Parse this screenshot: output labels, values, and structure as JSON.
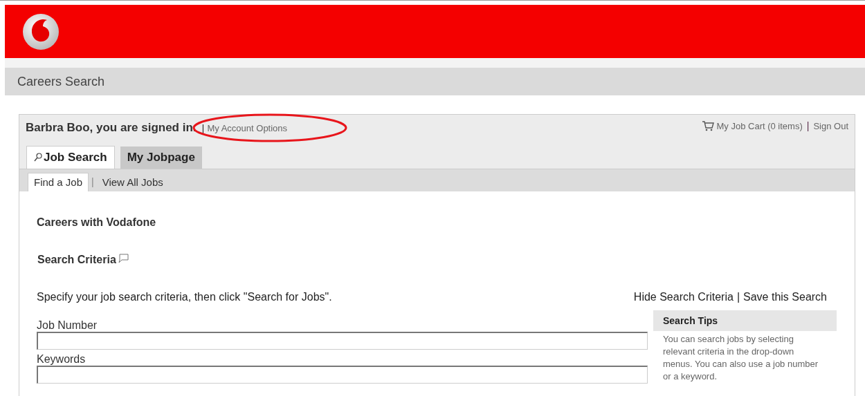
{
  "header": {
    "page_title": "Careers Search"
  },
  "account": {
    "greeting": "Barbra Boo, you are signed in.",
    "separator": "|",
    "account_link": "My Account Options",
    "cart_link": "My Job Cart (0 items)",
    "separator_2": "|",
    "sign_out": "Sign Out",
    "highlighted": true
  },
  "tabs": [
    {
      "label": "Job Search",
      "selected": true,
      "has_icon": true
    },
    {
      "label": "My Jobpage",
      "selected": false,
      "has_icon": false
    }
  ],
  "subtabs": [
    {
      "label": "Find a Job",
      "selected": true
    },
    {
      "label": "View All Jobs",
      "selected": false
    }
  ],
  "subtab_separator": "|",
  "content": {
    "heading": "Careers with Vodafone",
    "section_title": "Search Criteria",
    "instruction": "Specify your job search criteria, then click \"Search for Jobs\".",
    "links": [
      "Hide Search Criteria",
      "Save this Search"
    ],
    "link_separator": "|",
    "fields": [
      {
        "label": "Job Number"
      },
      {
        "label": "Keywords"
      }
    ],
    "tips": {
      "title": "Search Tips",
      "text": "You can search jobs by selecting relevant criteria in the drop-down menus. You can also use a job number or a keyword."
    }
  }
}
